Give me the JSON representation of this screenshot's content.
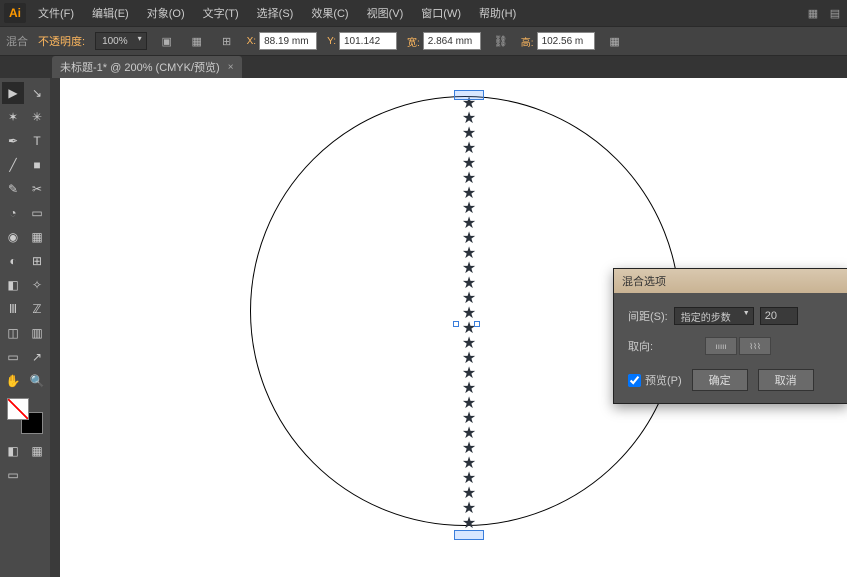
{
  "app": {
    "logo": "Ai"
  },
  "menu": {
    "items": [
      "文件(F)",
      "编辑(E)",
      "对象(O)",
      "文字(T)",
      "选择(S)",
      "效果(C)",
      "视图(V)",
      "窗口(W)",
      "帮助(H)"
    ]
  },
  "options": {
    "blend_label": "混合",
    "opacity_label": "不透明度:",
    "opacity_value": "100%",
    "x_label": "X:",
    "x_value": "88.19 mm",
    "y_label": "Y:",
    "y_value": "101.142",
    "w_label": "宽:",
    "w_value": "2.864 mm",
    "h_label": "高:",
    "h_value": "102.56 m"
  },
  "tab": {
    "title": "未标题-1* @ 200% (CMYK/预览)",
    "close": "×"
  },
  "tools": {
    "items": [
      "▶",
      "↘",
      "✶",
      "✳",
      "✒",
      "T",
      "╱",
      "■",
      "✎",
      "✂",
      "◔",
      "▭",
      "◉",
      "▦",
      "◐",
      "⊞",
      "◧",
      "✧",
      "Ⅲ",
      "ℤ",
      "◫",
      "▥",
      "▭",
      "↗",
      "✋",
      "🔍",
      "?"
    ]
  },
  "dialog": {
    "title": "混合选项",
    "spacing_label": "间距(S):",
    "spacing_mode": "指定的步数",
    "spacing_value": "20",
    "orient_label": "取向:",
    "preview_label": "预览(P)",
    "ok": "确定",
    "cancel": "取消"
  }
}
